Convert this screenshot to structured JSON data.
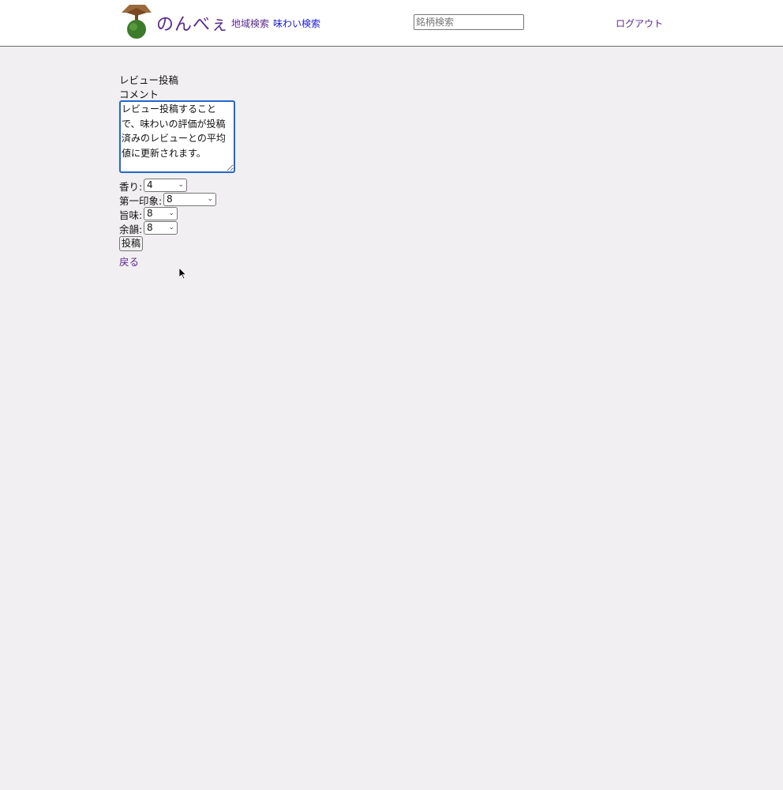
{
  "header": {
    "brand": "のんべぇ",
    "nav": {
      "region_search": "地域検索",
      "taste_search": "味わい検索"
    },
    "search": {
      "placeholder": "銘柄検索",
      "value": ""
    },
    "logout": "ログアウト"
  },
  "form": {
    "title": "レビュー投稿",
    "comment_label": "コメント",
    "comment_value": "レビュー投稿することで、味わいの評価が投稿済みのレビューとの平均値に更新されます。",
    "ratings": {
      "aroma": {
        "label": "香り:",
        "value": "4"
      },
      "first_impression": {
        "label": "第一印象:",
        "value": "8"
      },
      "umami": {
        "label": "旨味:",
        "value": "8"
      },
      "finish": {
        "label": "余韻:",
        "value": "8"
      }
    },
    "submit_label": "投稿",
    "back_label": "戻る"
  },
  "icons": {
    "logo": "sake-tree-logo-icon",
    "select_arrow": "chevron-down-icon",
    "cursor": "mouse-pointer-icon"
  },
  "colors": {
    "background": "#f1eff1",
    "header_background": "#ffffff",
    "link_visited": "#5a2a8c",
    "link": "#1a1ad0",
    "focus_ring": "#2267c9"
  }
}
